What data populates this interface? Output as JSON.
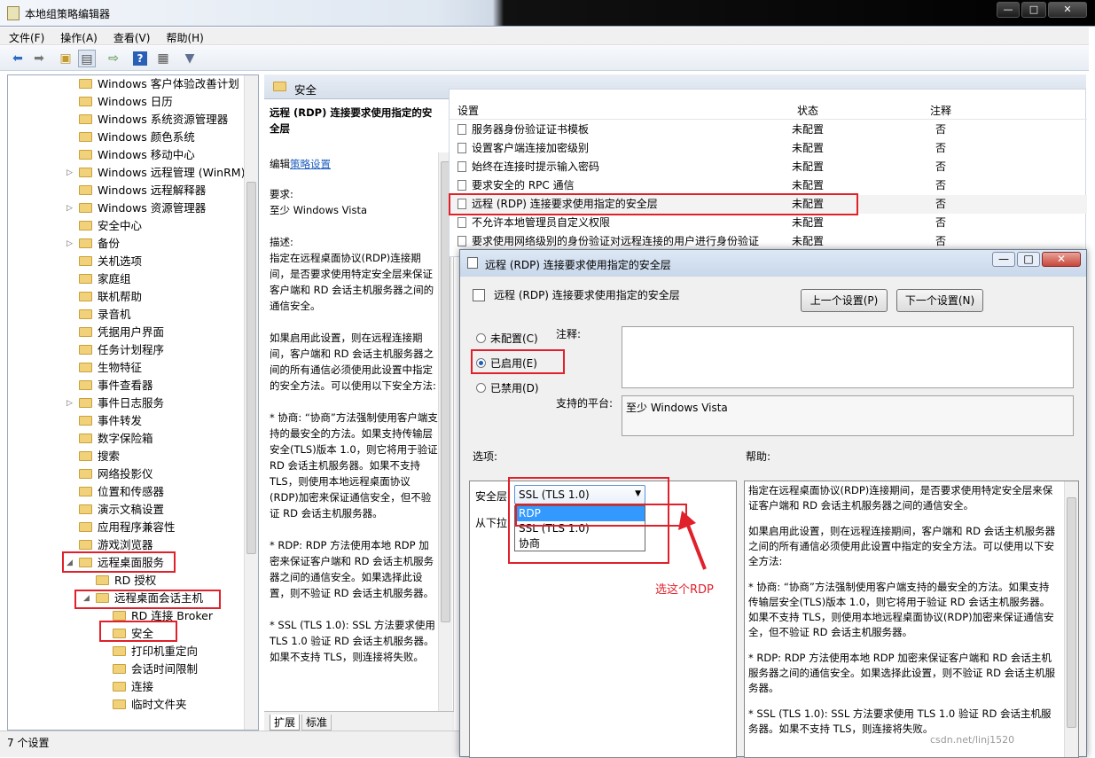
{
  "window": {
    "title": "本地组策略编辑器",
    "minimize": "—",
    "maximize": "□",
    "close": "✕"
  },
  "menu": [
    "文件(F)",
    "操作(A)",
    "查看(V)",
    "帮助(H)"
  ],
  "tree": [
    {
      "label": "Windows 客户体验改善计划",
      "indent": 0,
      "expand": ""
    },
    {
      "label": "Windows 日历",
      "indent": 0,
      "expand": ""
    },
    {
      "label": "Windows 系统资源管理器",
      "indent": 0,
      "expand": ""
    },
    {
      "label": "Windows 颜色系统",
      "indent": 0,
      "expand": ""
    },
    {
      "label": "Windows 移动中心",
      "indent": 0,
      "expand": ""
    },
    {
      "label": "Windows 远程管理 (WinRM)",
      "indent": 0,
      "expand": "▷"
    },
    {
      "label": "Windows 远程解释器",
      "indent": 0,
      "expand": ""
    },
    {
      "label": "Windows 资源管理器",
      "indent": 0,
      "expand": "▷"
    },
    {
      "label": "安全中心",
      "indent": 0,
      "expand": ""
    },
    {
      "label": "备份",
      "indent": 0,
      "expand": "▷"
    },
    {
      "label": "关机选项",
      "indent": 0,
      "expand": ""
    },
    {
      "label": "家庭组",
      "indent": 0,
      "expand": ""
    },
    {
      "label": "联机帮助",
      "indent": 0,
      "expand": ""
    },
    {
      "label": "录音机",
      "indent": 0,
      "expand": ""
    },
    {
      "label": "凭据用户界面",
      "indent": 0,
      "expand": ""
    },
    {
      "label": "任务计划程序",
      "indent": 0,
      "expand": ""
    },
    {
      "label": "生物特征",
      "indent": 0,
      "expand": ""
    },
    {
      "label": "事件查看器",
      "indent": 0,
      "expand": ""
    },
    {
      "label": "事件日志服务",
      "indent": 0,
      "expand": "▷"
    },
    {
      "label": "事件转发",
      "indent": 0,
      "expand": ""
    },
    {
      "label": "数字保险箱",
      "indent": 0,
      "expand": ""
    },
    {
      "label": "搜索",
      "indent": 0,
      "expand": ""
    },
    {
      "label": "网络投影仪",
      "indent": 0,
      "expand": ""
    },
    {
      "label": "位置和传感器",
      "indent": 0,
      "expand": ""
    },
    {
      "label": "演示文稿设置",
      "indent": 0,
      "expand": ""
    },
    {
      "label": "应用程序兼容性",
      "indent": 0,
      "expand": ""
    },
    {
      "label": "游戏浏览器",
      "indent": 0,
      "expand": ""
    },
    {
      "label": "远程桌面服务",
      "indent": 0,
      "expand": "◢"
    },
    {
      "label": "RD 授权",
      "indent": 1,
      "expand": ""
    },
    {
      "label": "远程桌面会话主机",
      "indent": 1,
      "expand": "◢"
    },
    {
      "label": "RD 连接 Broker",
      "indent": 2,
      "expand": ""
    },
    {
      "label": "安全",
      "indent": 2,
      "expand": ""
    },
    {
      "label": "打印机重定向",
      "indent": 2,
      "expand": ""
    },
    {
      "label": "会话时间限制",
      "indent": 2,
      "expand": ""
    },
    {
      "label": "连接",
      "indent": 2,
      "expand": ""
    },
    {
      "label": "临时文件夹",
      "indent": 2,
      "expand": ""
    }
  ],
  "middle": {
    "header": "安全",
    "policy_title": "远程 (RDP) 连接要求使用指定的安全层",
    "edit_prefix": "编辑",
    "edit_link": "策略设置",
    "desc": [
      "要求:\n至少 Windows Vista",
      "描述:\n指定在远程桌面协议(RDP)连接期间，是否要求使用特定安全层来保证客户端和 RD 会话主机服务器之间的通信安全。",
      "如果启用此设置，则在远程连接期间，客户端和 RD 会话主机服务器之间的所有通信必须使用此设置中指定的安全方法。可以使用以下安全方法:",
      "* 协商: “协商”方法强制使用客户端支持的最安全的方法。如果支持传输层安全(TLS)版本 1.0，则它将用于验证 RD 会话主机服务器。如果不支持 TLS，则使用本地远程桌面协议(RDP)加密来保证通信安全，但不验证 RD 会话主机服务器。",
      "* RDP: RDP 方法使用本地 RDP 加密来保证客户端和 RD 会话主机服务器之间的通信安全。如果选择此设置，则不验证 RD 会话主机服务器。",
      "* SSL (TLS 1.0): SSL 方法要求使用 TLS 1.0 验证 RD 会话主机服务器。如果不支持 TLS，则连接将失败。"
    ],
    "tabs": [
      "扩展",
      "标准"
    ]
  },
  "list": {
    "columns": [
      "设置",
      "状态",
      "注释"
    ],
    "rows": [
      {
        "name": "服务器身份验证证书模板",
        "state": "未配置",
        "note": "否"
      },
      {
        "name": "设置客户端连接加密级别",
        "state": "未配置",
        "note": "否"
      },
      {
        "name": "始终在连接时提示输入密码",
        "state": "未配置",
        "note": "否"
      },
      {
        "name": "要求安全的 RPC 通信",
        "state": "未配置",
        "note": "否"
      },
      {
        "name": "远程 (RDP) 连接要求使用指定的安全层",
        "state": "未配置",
        "note": "否"
      },
      {
        "name": "不允许本地管理员自定义权限",
        "state": "未配置",
        "note": "否"
      },
      {
        "name": "要求使用网络级别的身份验证对远程连接的用户进行身份验证",
        "state": "未配置",
        "note": "否"
      }
    ]
  },
  "status_bar": "7 个设置",
  "dialog": {
    "title": "远程 (RDP) 连接要求使用指定的安全层",
    "subtitle": "远程 (RDP) 连接要求使用指定的安全层",
    "prev_button": "上一个设置(P)",
    "next_button": "下一个设置(N)",
    "radios": [
      "未配置(C)",
      "已启用(E)",
      "已禁用(D)"
    ],
    "selected": "已启用(E)",
    "comment_label": "注释:",
    "platform_label": "支持的平台:",
    "platform_value": "至少 Windows Vista",
    "options_label": "选项:",
    "help_label": "帮助:",
    "security_layer_label": "安全层",
    "security_layer_value": "SSL (TLS 1.0)",
    "dropdown_options": [
      "RDP",
      "SSL (TLS 1.0)",
      "协商"
    ],
    "from_list_text": "从下拉",
    "help": [
      "指定在远程桌面协议(RDP)连接期间，是否要求使用特定安全层来保证客户端和 RD 会话主机服务器之间的通信安全。",
      "如果启用此设置，则在远程连接期间，客户端和 RD 会话主机服务器之间的所有通信必须使用此设置中指定的安全方法。可以使用以下安全方法:",
      "* 协商: “协商”方法强制使用客户端支持的最安全的方法。如果支持传输层安全(TLS)版本 1.0，则它将用于验证 RD 会话主机服务器。如果不支持 TLS，则使用本地远程桌面协议(RDP)加密来保证通信安全，但不验证 RD 会话主机服务器。",
      "* RDP: RDP 方法使用本地 RDP 加密来保证客户端和 RD 会话主机服务器之间的通信安全。如果选择此设置，则不验证 RD 会话主机服务器。",
      "* SSL (TLS 1.0): SSL 方法要求使用 TLS 1.0 验证 RD 会话主机服务器。如果不支持 TLS，则连接将失败。"
    ]
  },
  "annotation": {
    "text": "选这个RDP",
    "color": "#e0202a"
  },
  "watermark": "csdn.net/linj1520"
}
